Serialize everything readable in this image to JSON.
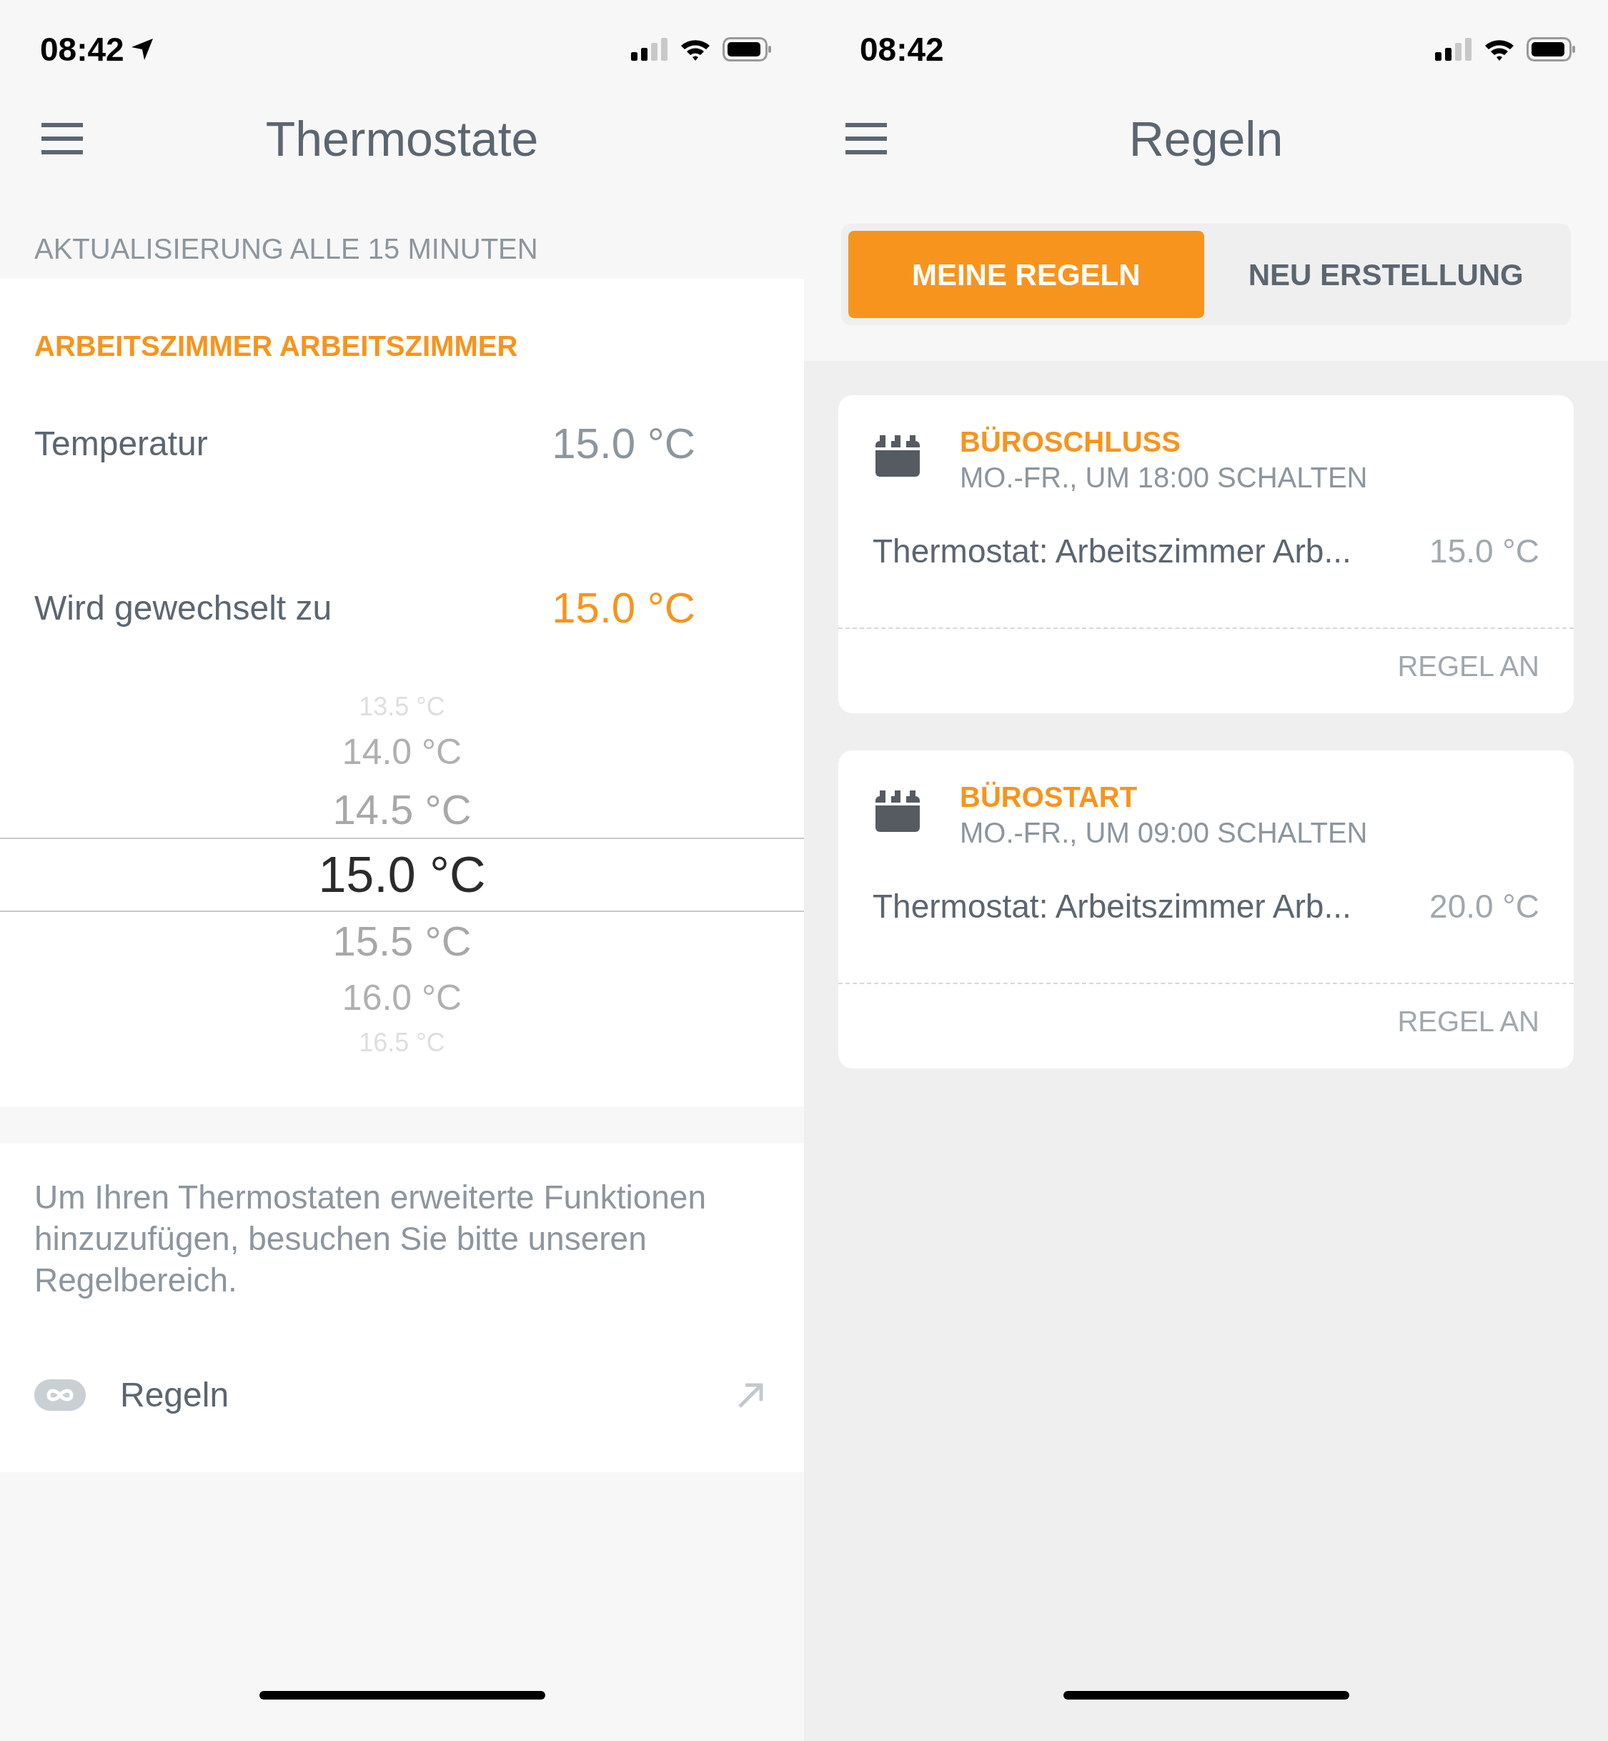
{
  "screens": [
    {
      "status_bar": {
        "time": "08:42",
        "location": true
      },
      "title": "Thermostate",
      "section_header": "AKTUALISIERUNG ALLE 15 MINUTEN",
      "device": {
        "name": "ARBEITSZIMMER ARBEITSZIMMER",
        "rows": [
          {
            "label": "Temperatur",
            "value": "15.0 °C",
            "highlight": false
          },
          {
            "label": "Wird gewechselt zu",
            "value": "15.0 °C",
            "highlight": true
          }
        ],
        "picker": [
          {
            "label": "13.5 °C",
            "selected": false
          },
          {
            "label": "14.0 °C",
            "selected": false
          },
          {
            "label": "14.5 °C",
            "selected": false
          },
          {
            "label": "15.0 °C",
            "selected": true
          },
          {
            "label": "15.5 °C",
            "selected": false
          },
          {
            "label": "16.0 °C",
            "selected": false
          },
          {
            "label": "16.5 °C",
            "selected": false
          }
        ]
      },
      "info": {
        "text": "Um Ihren Thermostaten erweiterte Funktionen hinzuzufügen, besuchen Sie bitte unseren Regelbereich.",
        "link": "Regeln"
      }
    },
    {
      "status_bar": {
        "time": "08:42",
        "location": false
      },
      "title": "Regeln",
      "tabs": [
        {
          "label": "MEINE REGELN",
          "selected": true
        },
        {
          "label": "NEU ERSTELLUNG",
          "selected": false
        }
      ],
      "rules": [
        {
          "name": "BÜROSCHLUSS",
          "schedule": "MO.-FR., UM 18:00 SCHALTEN",
          "action": "Thermostat: Arbeitszimmer Arb...",
          "value": "15.0 °C",
          "status": "REGEL AN"
        },
        {
          "name": "BÜROSTART",
          "schedule": "MO.-FR., UM 09:00 SCHALTEN",
          "action": "Thermostat: Arbeitszimmer Arb...",
          "value": "20.0 °C",
          "status": "REGEL AN"
        }
      ]
    }
  ]
}
